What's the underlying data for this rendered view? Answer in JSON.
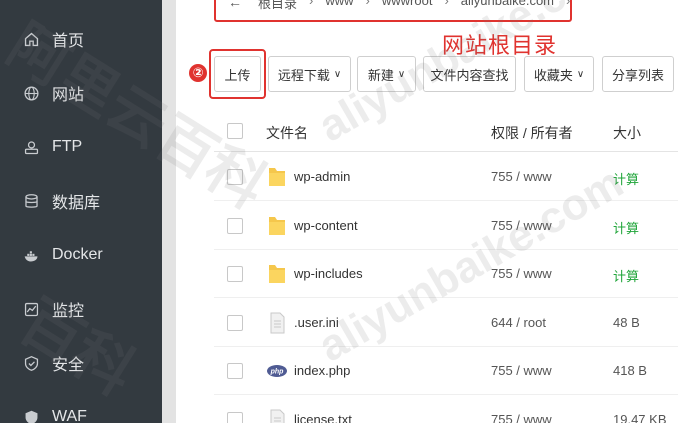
{
  "sidebar": {
    "items": [
      {
        "label": "首页",
        "icon": "home-icon"
      },
      {
        "label": "网站",
        "icon": "globe-icon"
      },
      {
        "label": "FTP",
        "icon": "ftp-icon"
      },
      {
        "label": "数据库",
        "icon": "database-icon"
      },
      {
        "label": "Docker",
        "icon": "docker-icon"
      },
      {
        "label": "监控",
        "icon": "monitor-icon"
      },
      {
        "label": "安全",
        "icon": "shield-icon"
      },
      {
        "label": "WAF",
        "icon": "waf-icon"
      }
    ]
  },
  "breadcrumb": {
    "back": "←",
    "items": [
      "根目录",
      "www",
      "wwwroot",
      "aliyunbaike.com"
    ],
    "separator": "›"
  },
  "annotation": {
    "text": "网站根目录",
    "step": "②",
    "color": "#e0332f"
  },
  "toolbar": {
    "upload": "上传",
    "remote_download": "远程下载",
    "new": "新建",
    "search_content": "文件内容查找",
    "favorites": "收藏夹",
    "share_list": "分享列表",
    "caret": "∨"
  },
  "table": {
    "headers": {
      "name": "文件名",
      "perm": "权限 / 所有者",
      "size": "大小"
    },
    "rows": [
      {
        "name": "wp-admin",
        "perm": "755 / www",
        "size": "计算",
        "type": "folder"
      },
      {
        "name": "wp-content",
        "perm": "755 / www",
        "size": "计算",
        "type": "folder"
      },
      {
        "name": "wp-includes",
        "perm": "755 / www",
        "size": "计算",
        "type": "folder"
      },
      {
        "name": ".user.ini",
        "perm": "644 / root",
        "size": "48 B",
        "type": "file"
      },
      {
        "name": "index.php",
        "perm": "755 / www",
        "size": "418 B",
        "type": "php"
      },
      {
        "name": "license.txt",
        "perm": "755 / www",
        "size": "19.47 KB",
        "type": "file"
      }
    ]
  },
  "watermarks": [
    "阿里云百科",
    "aliyunbaike.com",
    "aliyunbaike.com",
    "百科"
  ],
  "colors": {
    "accent": "#e0332f",
    "calc": "#20a53a",
    "sidebar": "#333a40"
  }
}
